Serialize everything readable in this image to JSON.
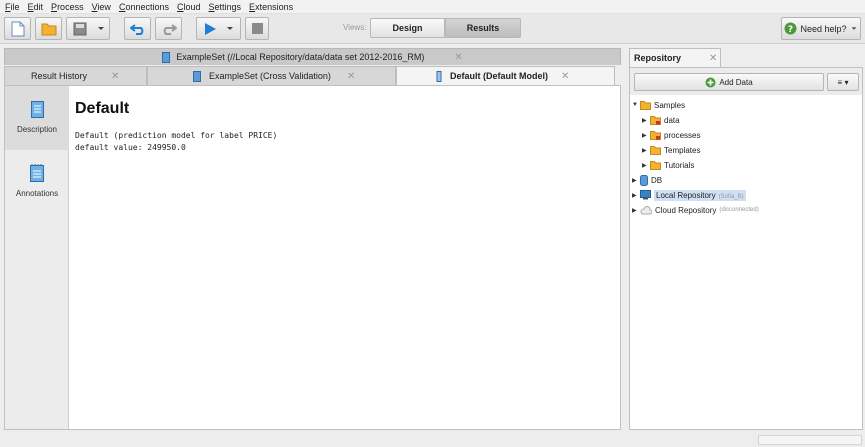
{
  "menu": [
    "File",
    "Edit",
    "Process",
    "View",
    "Connections",
    "Cloud",
    "Settings",
    "Extensions"
  ],
  "toolbar": {
    "views_label": "Views:",
    "design_label": "Design",
    "results_label": "Results",
    "help_label": "Need help?"
  },
  "tabs_row1": {
    "label": "ExampleSet (//Local Repository/data/data set 2012-2016_RM)"
  },
  "tabs_row2": [
    {
      "label": "Result History",
      "active": false
    },
    {
      "label": "ExampleSet (Cross Validation)",
      "active": false
    },
    {
      "label": "Default (Default Model)",
      "active": true
    }
  ],
  "close_glyph": "✕",
  "side": {
    "description_label": "Description",
    "annotations_label": "Annotations"
  },
  "model": {
    "title": "Default",
    "line1": "Default (prediction model for label PRICE)",
    "line2": "default value: 249950.0"
  },
  "repository": {
    "tab_label": "Repository",
    "add_data_label": "Add Data",
    "menu_label": "≡ ▾",
    "tree": {
      "samples": "Samples",
      "data": "data",
      "processes": "processes",
      "templates": "Templates",
      "tutorials": "Tutorials",
      "db": "DB",
      "local_repo": "Local Repository",
      "local_repo_sub": "(Sofia_B)",
      "cloud_repo": "Cloud Repository",
      "cloud_repo_sub": "(disconnected)"
    }
  },
  "colors": {
    "accent_blue": "#1f7fd6",
    "folder_yellow": "#f2b233",
    "help_green": "#4a9a3a"
  }
}
